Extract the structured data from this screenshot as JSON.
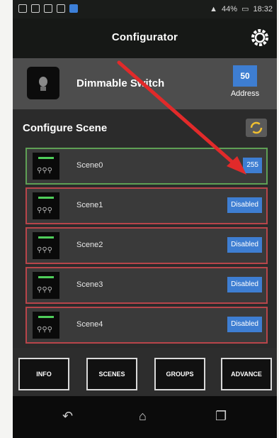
{
  "status_bar": {
    "battery": "44%",
    "time": "18:32"
  },
  "app_bar": {
    "title": "Configurator"
  },
  "device": {
    "name": "Dimmable Switch",
    "address_value": "50",
    "address_label": "Address"
  },
  "section": {
    "title": "Configure Scene"
  },
  "scenes": [
    {
      "name": "Scene0",
      "status": "255"
    },
    {
      "name": "Scene1",
      "status": "Disabled"
    },
    {
      "name": "Scene2",
      "status": "Disabled"
    },
    {
      "name": "Scene3",
      "status": "Disabled"
    },
    {
      "name": "Scene4",
      "status": "Disabled"
    }
  ],
  "tabs": [
    "INFO",
    "SCENES",
    "GROUPS",
    "ADVANCE"
  ],
  "colors": {
    "accent": "#3e7ed2",
    "active_border": "#5fa055",
    "disabled_border": "#b8454a",
    "annotation_arrow": "#e12a2a"
  }
}
